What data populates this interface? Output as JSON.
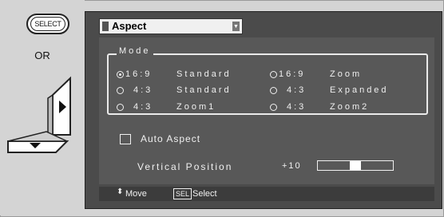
{
  "left_panel": {
    "select_button_label": "SELECT",
    "or_text": "OR"
  },
  "menu": {
    "title": "Aspect",
    "mode_group": {
      "legend": "Mode",
      "options": [
        {
          "aspect": "16:9",
          "name": "Standard",
          "selected": true
        },
        {
          "aspect": "16:9",
          "name": "Zoom",
          "selected": false
        },
        {
          "aspect": "4:3",
          "name": "Standard",
          "selected": false
        },
        {
          "aspect": "4:3",
          "name": "Expanded",
          "selected": false
        },
        {
          "aspect": "4:3",
          "name": "Zoom1",
          "selected": false
        },
        {
          "aspect": "4:3",
          "name": "Zoom2",
          "selected": false
        }
      ]
    },
    "auto_aspect": {
      "label": "Auto Aspect",
      "checked": false
    },
    "vertical_position": {
      "label": "Vertical Position",
      "value": "+10",
      "level_fraction": 0.5
    },
    "footer": {
      "move_icon": "up-down-arrows-icon",
      "move_label": "Move",
      "select_badge": "SEL",
      "select_label": "Select"
    }
  }
}
